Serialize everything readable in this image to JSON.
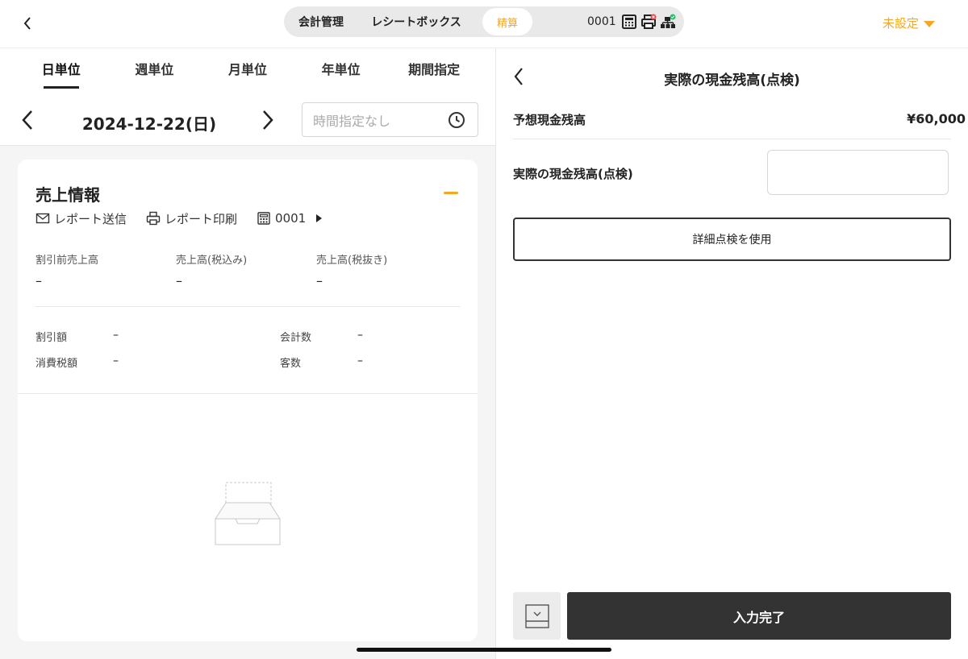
{
  "topbar": {
    "tabs": [
      {
        "label": "会計管理"
      },
      {
        "label": "レシートボックス"
      },
      {
        "label": "精算",
        "active": true
      }
    ],
    "register_code": "0001",
    "device_icons": [
      "register-icon",
      "printer-error-icon",
      "network-ok-icon"
    ],
    "unset_label": "未設定"
  },
  "left": {
    "period_tabs": [
      {
        "label": "日単位",
        "active": true
      },
      {
        "label": "週単位"
      },
      {
        "label": "月単位"
      },
      {
        "label": "年単位"
      },
      {
        "label": "期間指定"
      }
    ],
    "date": "2024-12-22(日)",
    "time_placeholder": "時間指定なし",
    "card": {
      "title": "売上情報",
      "actions": {
        "send": "レポート送信",
        "print": "レポート印刷",
        "register": "0001"
      },
      "metrics": [
        {
          "label": "割引前売上高",
          "value": "–"
        },
        {
          "label": "売上高(税込み)",
          "value": "–"
        },
        {
          "label": "売上高(税抜き)",
          "value": "–"
        }
      ],
      "details": {
        "discount": {
          "label": "割引額",
          "value": "–"
        },
        "tax": {
          "label": "消費税額",
          "value": "–"
        },
        "checkouts": {
          "label": "会計数",
          "value": "–"
        },
        "customers": {
          "label": "客数",
          "value": "–"
        }
      }
    }
  },
  "right": {
    "title": "実際の現金残高(点検)",
    "expected_label": "予想現金残高",
    "expected_value": "¥60,000",
    "actual_label": "実際の現金残高(点検)",
    "actual_value": "",
    "detail_button": "詳細点検を使用",
    "done_button": "入力完了"
  },
  "colors": {
    "accent": "#f5a623",
    "primary_button": "#333333"
  }
}
